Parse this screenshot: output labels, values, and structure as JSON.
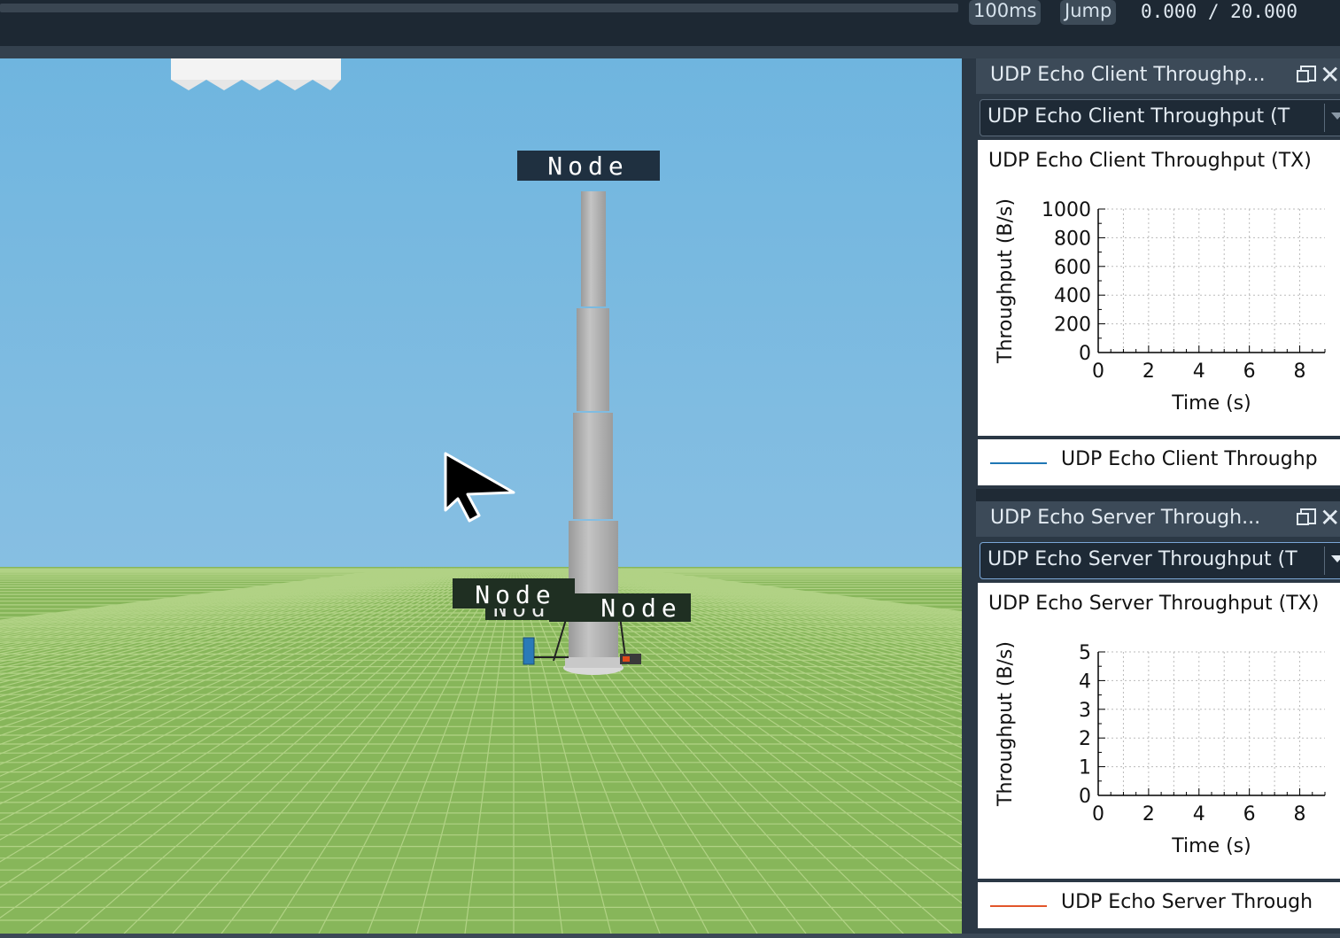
{
  "toolbar": {
    "step_label": "100ms",
    "jump_label": "Jump",
    "time_display": "0.000 / 20.000"
  },
  "scene": {
    "node_labels": [
      "Node",
      "Node",
      "Node",
      "Node"
    ],
    "colors": {
      "sky": "#72b6df",
      "ground": "#87b65a",
      "grid": "#b9d68f"
    }
  },
  "panels": [
    {
      "title": "UDP Echo Client Throughp...",
      "combo_value": "UDP Echo Client Throughput (T",
      "plot_title": "UDP Echo Client Throughput (TX)",
      "legend_label": "UDP Echo Client Throughp",
      "chart_data": {
        "type": "line",
        "title": "UDP Echo Client Throughput (TX)",
        "xlabel": "Time (s)",
        "ylabel": "Throughput (B/s)",
        "xlim": [
          0,
          9
        ],
        "ylim": [
          0,
          1000
        ],
        "xticks": [
          0,
          2,
          4,
          6,
          8
        ],
        "yticks": [
          0,
          200,
          400,
          600,
          800,
          1000
        ],
        "grid": true,
        "series": [
          {
            "name": "UDP Echo Client Throughp",
            "color": "#1f77b4",
            "x": [],
            "y": []
          }
        ]
      }
    },
    {
      "title": "UDP Echo Server Through...",
      "combo_value": "UDP Echo Server Throughput (T",
      "plot_title": "UDP Echo Server Throughput (TX)",
      "legend_label": "UDP Echo Server Through",
      "chart_data": {
        "type": "line",
        "title": "UDP Echo Server Throughput (TX)",
        "xlabel": "Time (s)",
        "ylabel": "Throughput (B/s)",
        "xlim": [
          0,
          9
        ],
        "ylim": [
          0,
          5
        ],
        "xticks": [
          0,
          2,
          4,
          6,
          8
        ],
        "yticks": [
          0,
          1,
          2,
          3,
          4,
          5
        ],
        "grid": true,
        "series": [
          {
            "name": "UDP Echo Server Through",
            "color": "#e2562b",
            "x": [],
            "y": []
          }
        ]
      }
    }
  ]
}
